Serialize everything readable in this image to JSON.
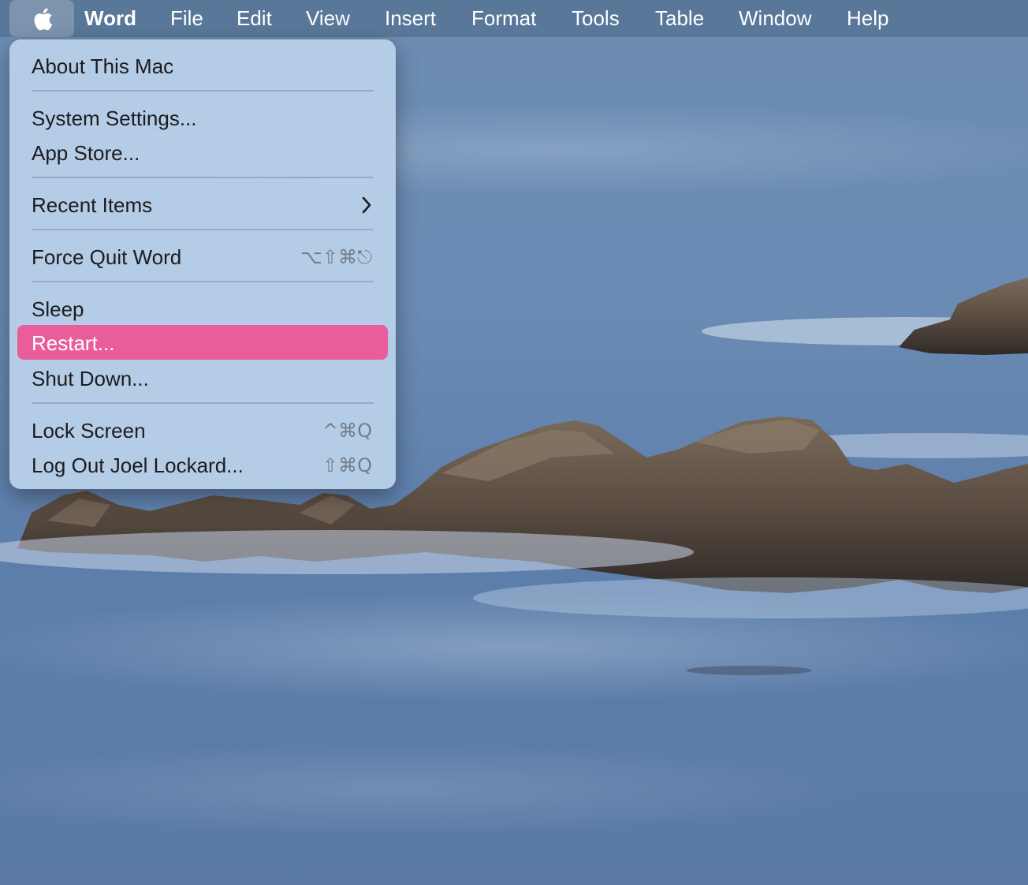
{
  "menubar": {
    "apple_icon": "apple-logo-icon",
    "items": [
      {
        "label": "Word"
      },
      {
        "label": "File"
      },
      {
        "label": "Edit"
      },
      {
        "label": "View"
      },
      {
        "label": "Insert"
      },
      {
        "label": "Format"
      },
      {
        "label": "Tools"
      },
      {
        "label": "Table"
      },
      {
        "label": "Window"
      },
      {
        "label": "Help"
      }
    ]
  },
  "apple_menu": {
    "highlight_color": "#e85d9a",
    "items": [
      {
        "label": "About This Mac"
      },
      {
        "label": "System Settings..."
      },
      {
        "label": "App Store..."
      },
      {
        "label": "Recent Items",
        "submenu_icon": "chevron-right-icon"
      },
      {
        "label": "Force Quit Word",
        "shortcut": "⌥⇧⌘⎋"
      },
      {
        "label": "Sleep"
      },
      {
        "label": "Restart...",
        "selected": true
      },
      {
        "label": "Shut Down..."
      },
      {
        "label": "Lock Screen",
        "shortcut": "^⌘Q"
      },
      {
        "label": "Log Out Joel Lockard...",
        "shortcut": "⇧⌘Q"
      }
    ]
  },
  "wallpaper": {
    "description_icon": "coastal-rocks-wallpaper"
  }
}
